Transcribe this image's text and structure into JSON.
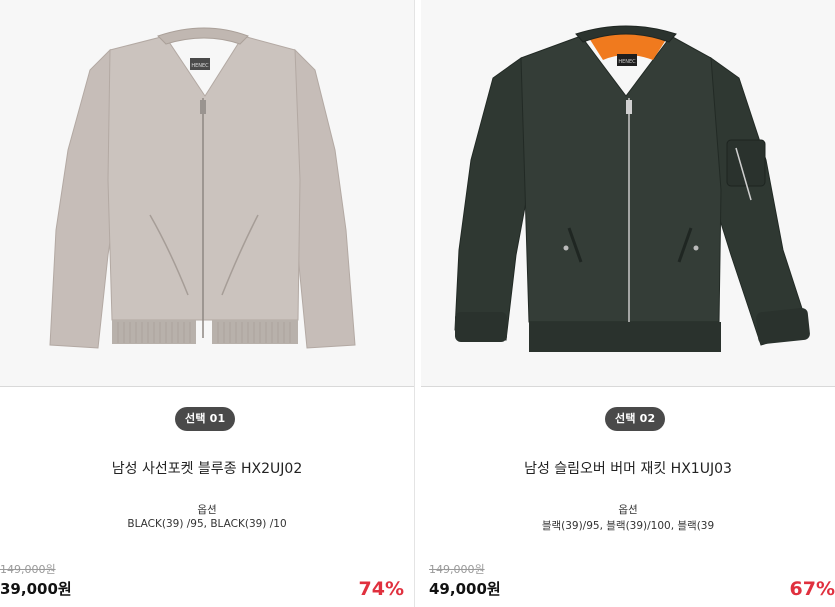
{
  "products": [
    {
      "badge": "선택 01",
      "name": "남성 사선포켓 블루종 HX2UJ02",
      "option_label": "옵션",
      "option_value": "BLACK(39) /95, BLACK(39) /10",
      "original_price": "149,000원",
      "sale_price": "39,000원",
      "discount": "74%",
      "jacket_color": "#c9c0bb",
      "image_label": "HENEC"
    },
    {
      "badge": "선택 02",
      "name": "남성 슬림오버 버머 재킷 HX1UJ03",
      "option_label": "옵션",
      "option_value": "블랙(39)/95, 블랙(39)/100, 블랙(39",
      "original_price": "149,000원",
      "sale_price": "49,000원",
      "discount": "67%",
      "jacket_color": "#343d37",
      "lining_color": "#f07a1e",
      "image_label": "HENEC"
    }
  ]
}
